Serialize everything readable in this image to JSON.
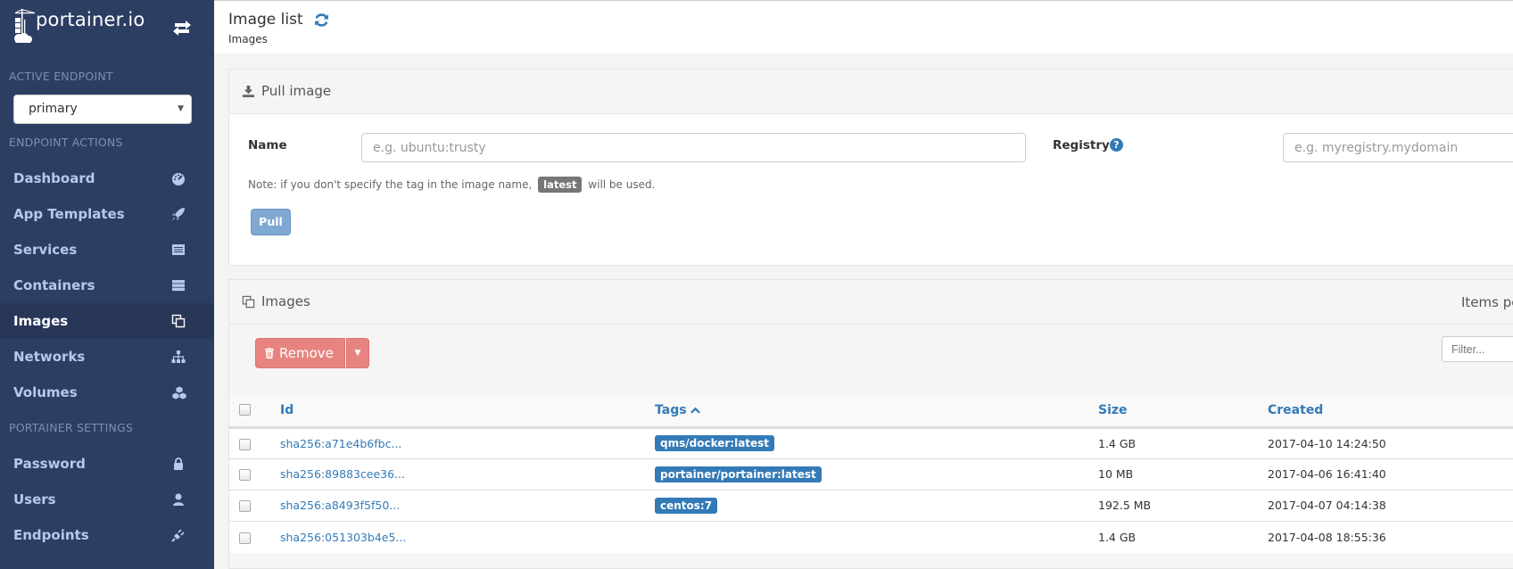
{
  "sidebar": {
    "brand": "portainer.io",
    "active_endpoint_heading": "ACTIVE ENDPOINT",
    "endpoint_selected": "primary",
    "endpoint_actions_heading": "ENDPOINT ACTIONS",
    "endpoint_items": [
      {
        "label": "Dashboard",
        "icon": "tachometer-icon"
      },
      {
        "label": "App Templates",
        "icon": "rocket-icon"
      },
      {
        "label": "Services",
        "icon": "list-alt-icon"
      },
      {
        "label": "Containers",
        "icon": "server-icon"
      },
      {
        "label": "Images",
        "icon": "clone-icon",
        "active": true
      },
      {
        "label": "Networks",
        "icon": "sitemap-icon"
      },
      {
        "label": "Volumes",
        "icon": "cubes-icon"
      }
    ],
    "settings_heading": "PORTAINER SETTINGS",
    "settings_items": [
      {
        "label": "Password",
        "icon": "lock-icon"
      },
      {
        "label": "Users",
        "icon": "user-icon"
      },
      {
        "label": "Endpoints",
        "icon": "plug-icon"
      }
    ]
  },
  "header": {
    "title": "Image list",
    "breadcrumb": "Images"
  },
  "pull_image": {
    "title": "Pull image",
    "name_label": "Name",
    "name_placeholder": "e.g. ubuntu:trusty",
    "registry_label": "Registry",
    "registry_placeholder": "e.g. myregistry.mydomain",
    "note_prefix": "Note: if you don't specify the tag in the image name,",
    "note_badge": "latest",
    "note_suffix": "will be used.",
    "pull_button": "Pull"
  },
  "images": {
    "title": "Images",
    "items_per_page_label": "Items pe",
    "remove_button": "Remove",
    "filter_placeholder": "Filter...",
    "columns": {
      "id": "Id",
      "tags": "Tags",
      "size": "Size",
      "created": "Created"
    },
    "sort_column": "Tags",
    "sort_direction": "ascending",
    "rows": [
      {
        "id": "sha256:a71e4b6fbc...",
        "tag": "qms/docker:latest",
        "size": "1.4 GB",
        "created": "2017-04-10 14:24:50"
      },
      {
        "id": "sha256:89883cee36...",
        "tag": "portainer/portainer:latest",
        "size": "10 MB",
        "created": "2017-04-06 16:41:40"
      },
      {
        "id": "sha256:a8493f5f50...",
        "tag": "centos:7",
        "size": "192.5 MB",
        "created": "2017-04-07 04:14:38"
      },
      {
        "id": "sha256:051303b4e5...",
        "tag": "",
        "size": "1.4 GB",
        "created": "2017-04-08 18:55:36"
      }
    ]
  },
  "colors": {
    "sidebar_bg": "#2d3e63",
    "accent": "#337ab7",
    "danger": "#e78480",
    "pull_button": "#7fa9d2"
  }
}
